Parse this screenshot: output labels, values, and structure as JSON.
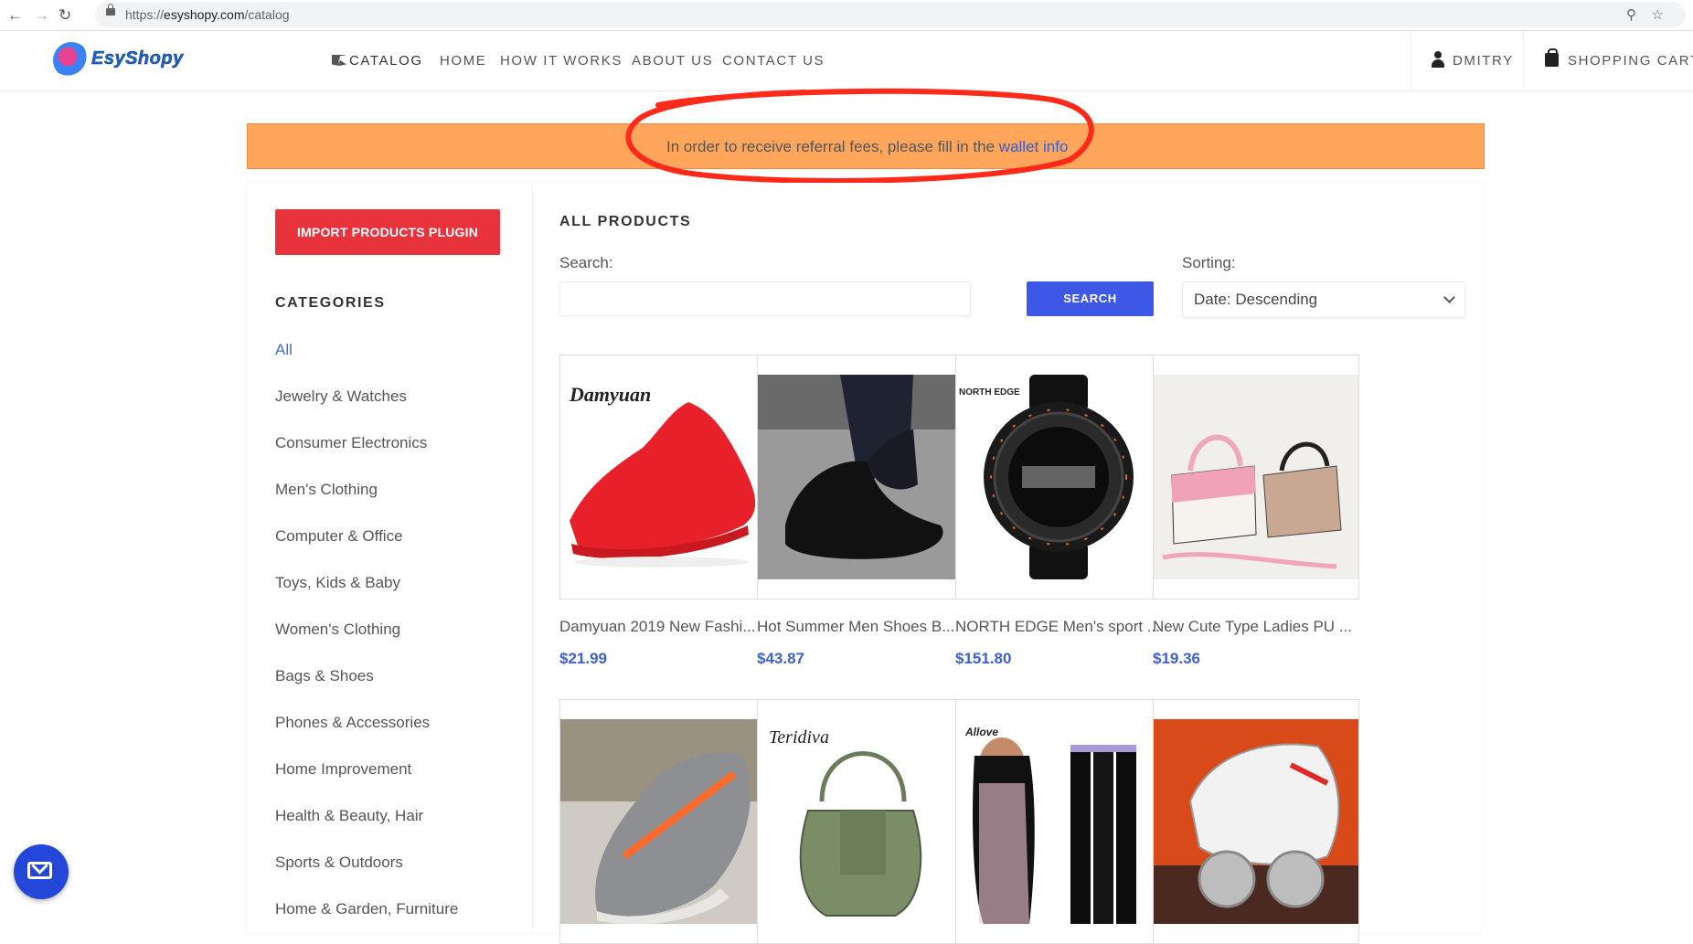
{
  "browser": {
    "url_scheme": "https://",
    "url_host": "esyshopy.com",
    "url_path": "/catalog"
  },
  "site": {
    "logo_text": "EsyShopy",
    "nav": [
      "CATALOG",
      "HOME",
      "HOW IT WORKS",
      "ABOUT US",
      "CONTACT US"
    ],
    "user_label": "DMITRY",
    "cart_label": "SHOPPING CART"
  },
  "alert": {
    "text": "In order to receive referral fees, please fill in the ",
    "link_text": "wallet info"
  },
  "sidebar": {
    "import_button": "IMPORT PRODUCTS PLUGIN",
    "categories_title": "CATEGORIES",
    "categories": [
      "All",
      "Jewelry & Watches",
      "Consumer Electronics",
      "Men's Clothing",
      "Computer & Office",
      "Toys, Kids & Baby",
      "Women's Clothing",
      "Bags & Shoes",
      "Phones & Accessories",
      "Home Improvement",
      "Health & Beauty, Hair",
      "Sports & Outdoors",
      "Home & Garden, Furniture"
    ]
  },
  "main": {
    "title": "ALL PRODUCTS",
    "search_label": "Search:",
    "search_button": "SEARCH",
    "sorting_label": "Sorting:",
    "sorting_value": "Date: Descending"
  },
  "products": [
    {
      "name": "Damyuan 2019 New Fashi...",
      "price": "$21.99",
      "brand": "Damyuan"
    },
    {
      "name": "Hot Summer Men Shoes B...",
      "price": "$43.87"
    },
    {
      "name": "NORTH EDGE Men's sport ...",
      "price": "$151.80",
      "brand": "NORTH EDGE"
    },
    {
      "name": "New Cute Type Ladies PU ...",
      "price": "$19.36"
    },
    {
      "name": "",
      "price": ""
    },
    {
      "name": "",
      "price": "",
      "brand": "Teridiva"
    },
    {
      "name": "",
      "price": "",
      "brand": "Allove"
    },
    {
      "name": "",
      "price": ""
    }
  ],
  "colors": {
    "accent_blue": "#3d57e6",
    "import_red": "#e8323c",
    "alert_orange": "#ffa65c",
    "price_blue": "#3d5fd0"
  }
}
